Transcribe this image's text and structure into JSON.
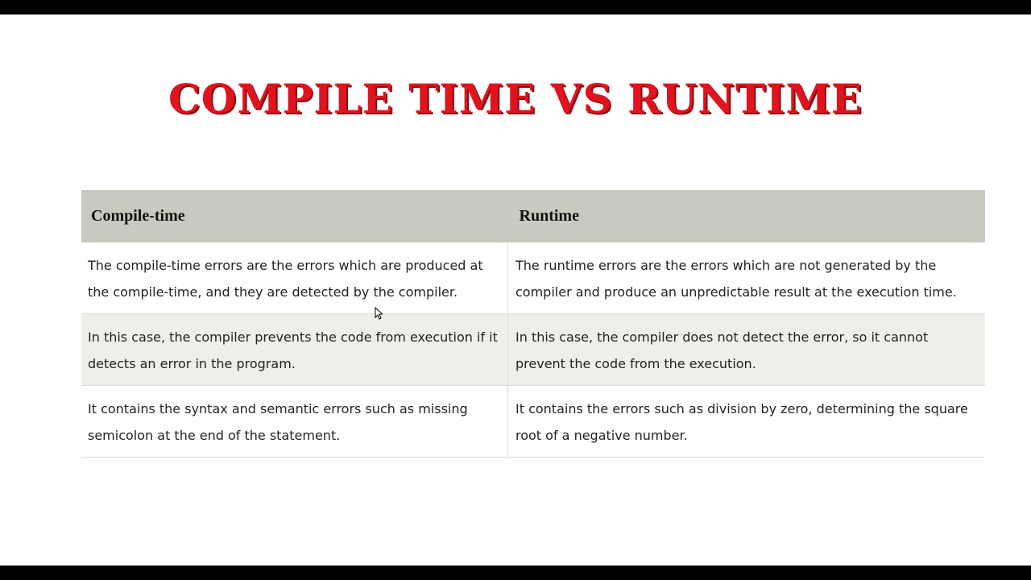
{
  "slide": {
    "title": "COMPILE TIME VS RUNTIME"
  },
  "table": {
    "headers": [
      "Compile-time",
      "Runtime"
    ],
    "rows": [
      [
        "The compile-time errors are the errors which are produced at the compile-time, and they are detected by the compiler.",
        "The runtime errors are the errors which are not generated by the compiler and produce an unpredictable result at the execution time."
      ],
      [
        "In this case, the compiler prevents the code from execution if it detects an error in the program.",
        "In this case, the compiler does not detect the error, so it cannot prevent the code from the execution."
      ],
      [
        "It contains the syntax and semantic errors such as missing semicolon at the end of the statement.",
        "It contains the errors such as division by zero, determining the square root of a negative number."
      ]
    ]
  },
  "colors": {
    "title": "#e0141e",
    "header_bg": "#c8cac0",
    "alt_row_bg": "#eeeeea"
  }
}
